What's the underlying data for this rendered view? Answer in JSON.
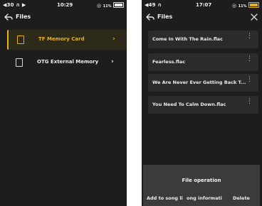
{
  "colors": {
    "accent": "#e4b31c",
    "background": "#1d1d1d",
    "card": "#2b2b2b",
    "sheet": "#3b3b3b"
  },
  "left_screen": {
    "status": {
      "left": "◀30 ∩ ▶",
      "time": "10:29",
      "battery_pct": "11%"
    },
    "header": {
      "title": "Files",
      "back_icon": "back-arrow-icon"
    },
    "items": [
      {
        "label": "TF Memory Card",
        "icon": "sd-card-icon",
        "chevron": "›",
        "selected": true
      },
      {
        "label": "OTG External Memory",
        "icon": "usb-drive-icon",
        "chevron": "›",
        "selected": false
      }
    ]
  },
  "right_screen": {
    "status": {
      "left": "◀49 ∩",
      "time": "17:07",
      "battery_pct": "11%"
    },
    "header": {
      "title": "Files",
      "close_icon": "close-icon"
    },
    "files": [
      {
        "name": "Come In With The Rain.flac"
      },
      {
        "name": "Fearless.flac"
      },
      {
        "name": "We Are Never Ever Getting Back T..."
      },
      {
        "name": "You Need To Calm Down.flac"
      }
    ],
    "more_glyph": "⋮",
    "operation_sheet": {
      "title": "File operation",
      "buttons": [
        "Add to song li",
        "ong informati",
        "Delete"
      ]
    }
  }
}
